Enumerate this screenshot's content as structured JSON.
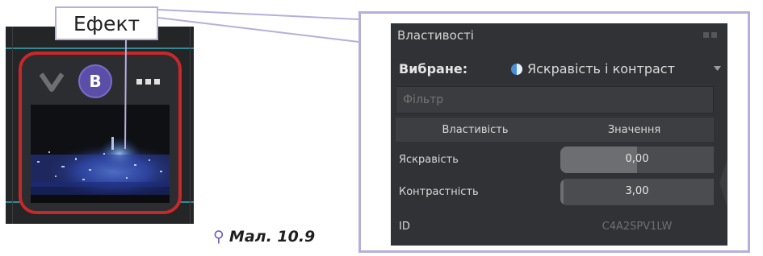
{
  "callout": {
    "label": "Ефект"
  },
  "clip": {
    "badge_letter": "B",
    "icons": [
      "checkmark-icon",
      "more-icon"
    ],
    "accent_color": "#c8282a"
  },
  "caption": {
    "text": "Мал. 10.9"
  },
  "properties_panel": {
    "title": "Властивості",
    "selected_label": "Вибране:",
    "selected_value": "Яскравість і контраст",
    "filter_placeholder": "Фільтр",
    "columns": {
      "property": "Властивість",
      "value": "Значення"
    },
    "rows": [
      {
        "name": "Яскравість",
        "value": "0,00",
        "level": 0.5
      },
      {
        "name": "Контрастність",
        "value": "3,00",
        "level": 0.02
      },
      {
        "name": "ID",
        "value": "C4A2SPV1LW"
      }
    ]
  }
}
